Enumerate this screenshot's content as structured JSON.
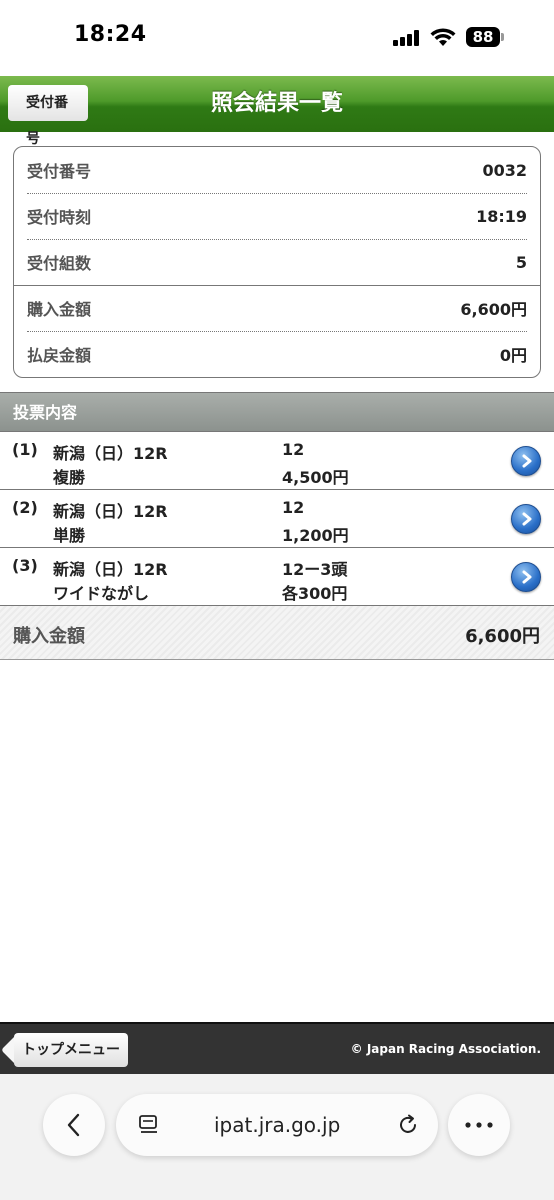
{
  "status_bar": {
    "time": "18:24",
    "battery": "88"
  },
  "header": {
    "back_label": "受付番号",
    "title": "照会結果一覧"
  },
  "summary": [
    {
      "label": "受付番号",
      "value": "0032"
    },
    {
      "label": "受付時刻",
      "value": "18:19"
    },
    {
      "label": "受付組数",
      "value": "5"
    },
    {
      "label": "購入金額",
      "value": "6,600円"
    },
    {
      "label": "払戻金額",
      "value": "0円"
    }
  ],
  "section": {
    "title": "投票内容"
  },
  "bets": [
    {
      "num": "(1)",
      "race": "新潟（日）12R",
      "type": "複勝",
      "horse": "12",
      "amount": "4,500円"
    },
    {
      "num": "(2)",
      "race": "新潟（日）12R",
      "type": "単勝",
      "horse": "12",
      "amount": "1,200円"
    },
    {
      "num": "(3)",
      "race": "新潟（日）12R",
      "type": "ワイドながし",
      "horse": "12ー3頭",
      "amount": "各300円"
    }
  ],
  "total": {
    "label": "購入金額",
    "value": "6,600円"
  },
  "footer": {
    "top_menu": "トップメニュー",
    "copyright": "© Japan Racing Association."
  },
  "browser": {
    "url": "ipat.jra.go.jp"
  },
  "colors": {
    "header_green": "#3f8a1f",
    "section_gray": "#9a9f9b",
    "link_blue": "#2a6fc8"
  }
}
